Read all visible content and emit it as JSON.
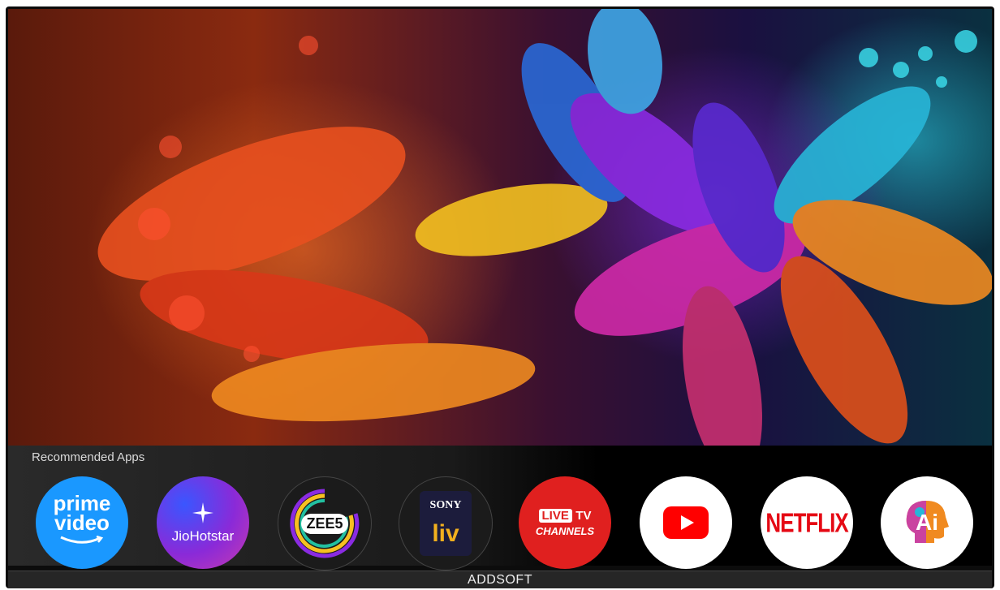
{
  "dock": {
    "title": "Recommended Apps"
  },
  "apps": [
    {
      "name": "Prime Video",
      "line1": "prime",
      "line2": "video",
      "bg": "#1a98ff"
    },
    {
      "name": "JioHotstar",
      "label": "JioHotstar",
      "bg": "#7b2ff7"
    },
    {
      "name": "ZEE5",
      "label": "ZEE5",
      "bg": "#1b1b1b"
    },
    {
      "name": "SonyLIV",
      "top": "SONY",
      "bottom": "liv",
      "bg": "#1b1b1b"
    },
    {
      "name": "Live TV Channels",
      "line1": "LIVE",
      "line1b": "TV",
      "line2": "CHANNELS",
      "bg": "#e0201f"
    },
    {
      "name": "YouTube",
      "bg": "#ffffff"
    },
    {
      "name": "Netflix",
      "label": "NETFLIX",
      "bg": "#ffffff"
    },
    {
      "name": "Ai",
      "label": "Ai",
      "bg": "#ffffff"
    }
  ],
  "footer": {
    "brand": "ADDSOFT"
  },
  "colors": {
    "netflix": "#e50914",
    "youtube": "#ff0000",
    "prime": "#1a98ff"
  },
  "icons": [
    "star-icon",
    "play-icon",
    "head-icon"
  ]
}
